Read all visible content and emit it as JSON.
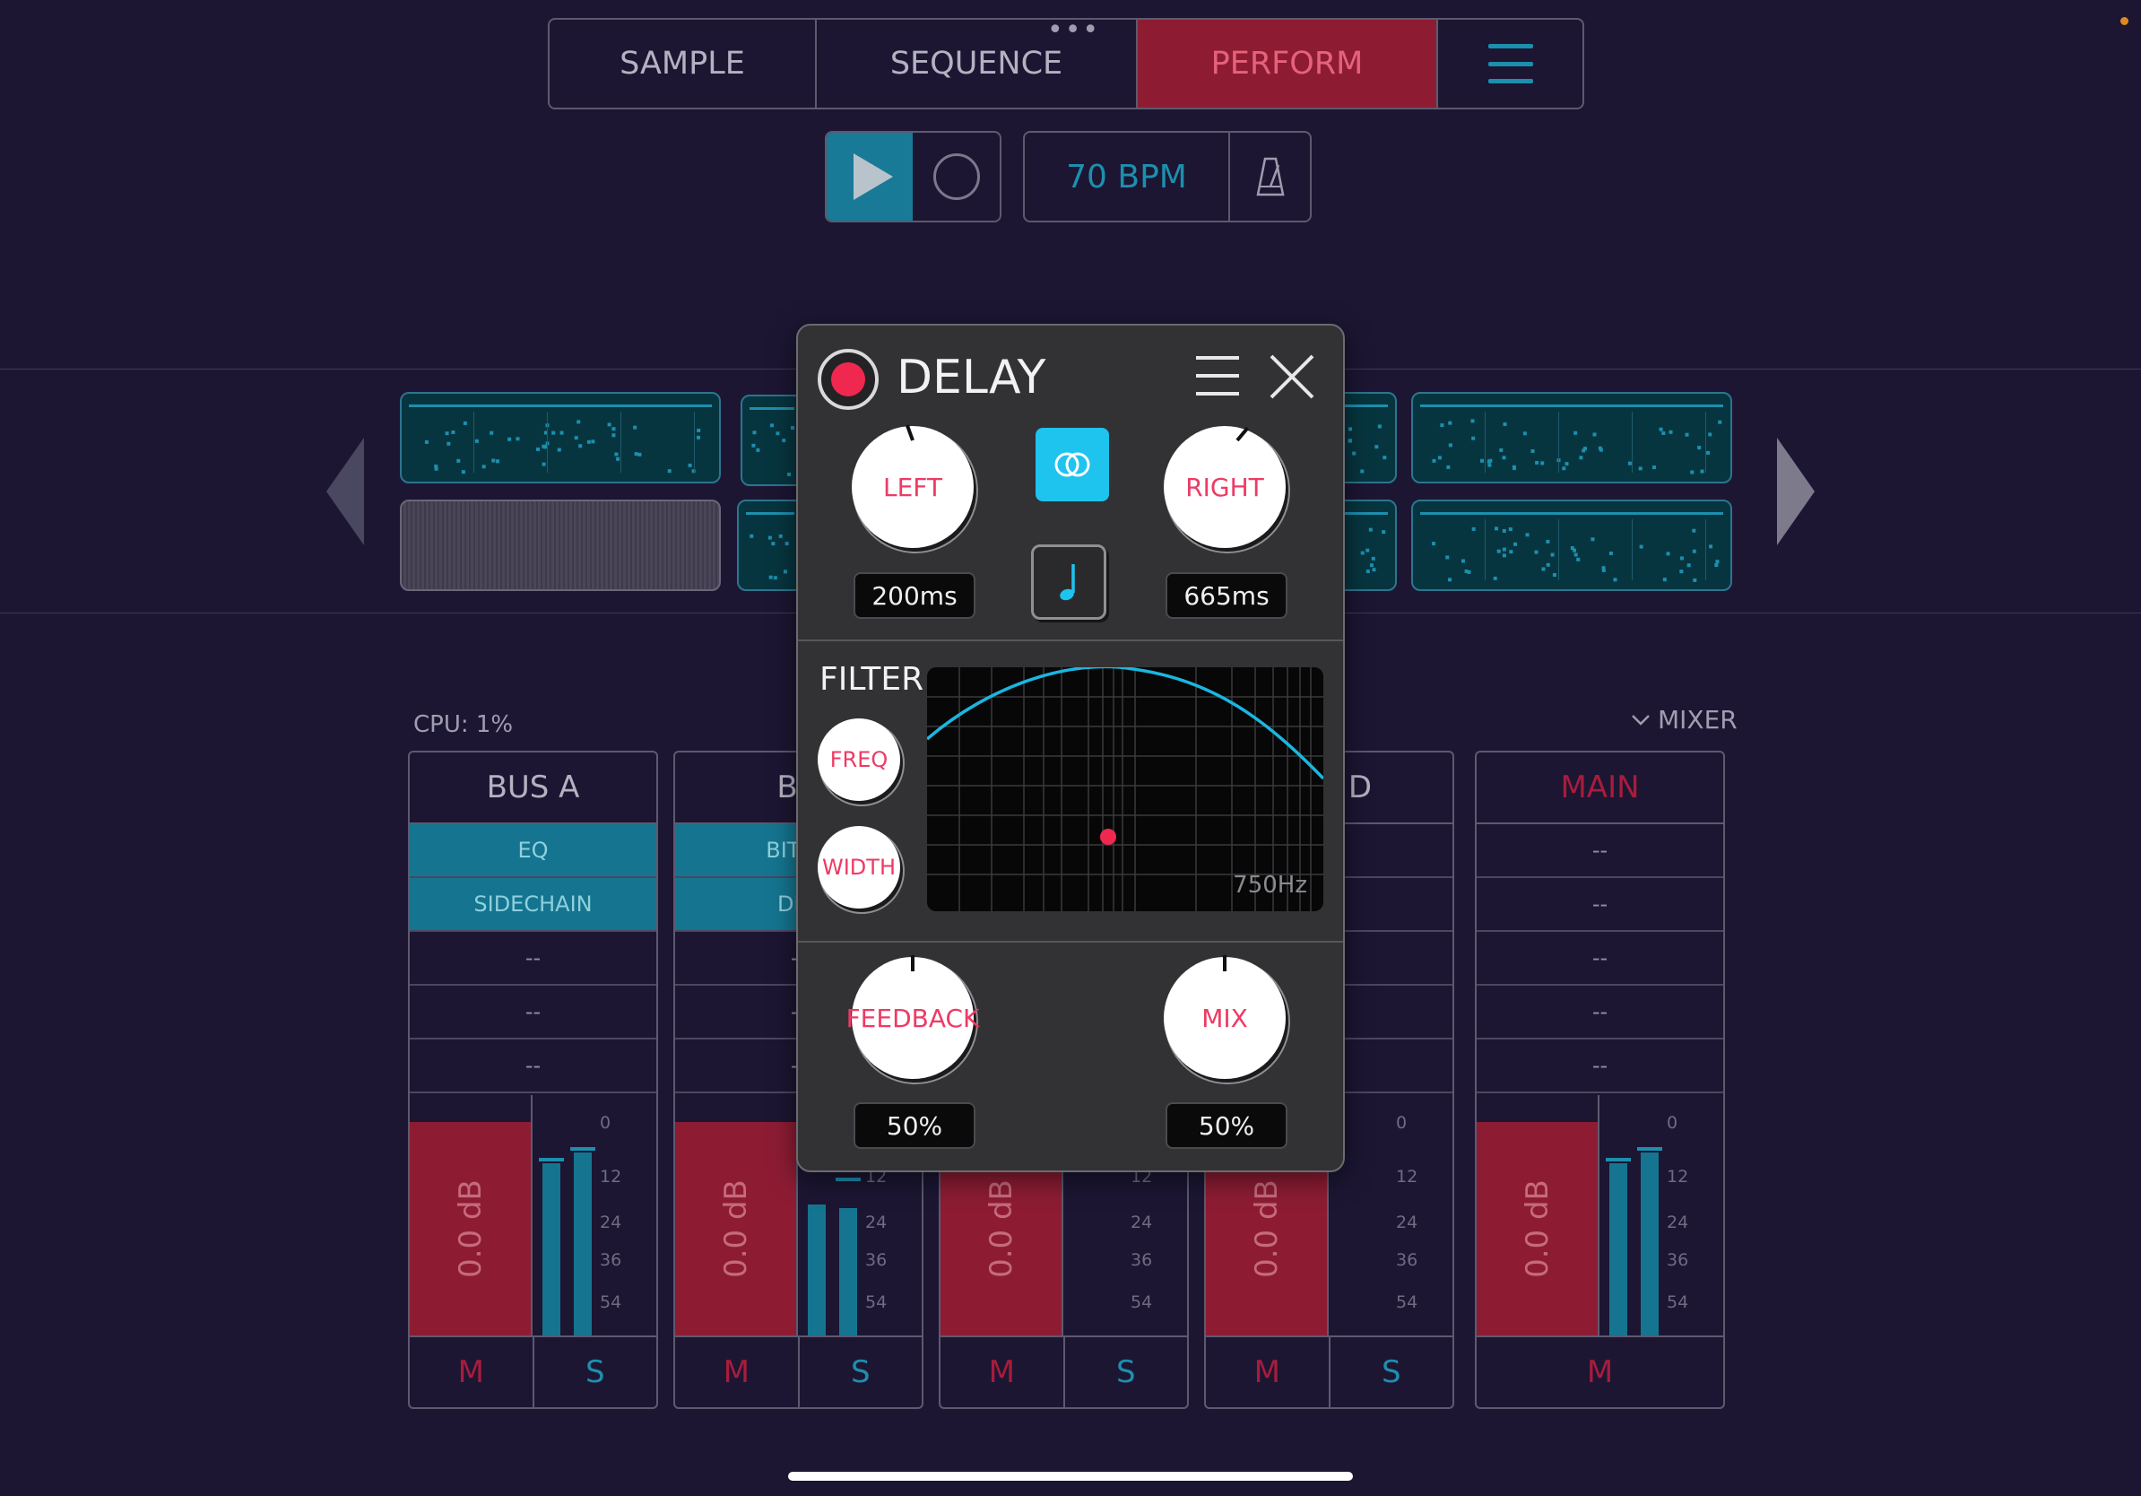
{
  "nav": {
    "tabs": [
      "SAMPLE",
      "SEQUENCE",
      "PERFORM"
    ],
    "active_tab": "PERFORM",
    "menu_icon": "hamburger-icon"
  },
  "transport": {
    "play_icon": "play-icon",
    "record_icon": "record-icon",
    "bpm": "70 BPM",
    "metronome_icon": "metronome-icon"
  },
  "mixer": {
    "cpu": "CPU: 1%",
    "toggle_label": "MIXER",
    "channels": [
      {
        "name": "BUS A",
        "slots": [
          "EQ",
          "SIDECHAIN",
          "--",
          "--",
          "--"
        ],
        "fader": "0.0 dB",
        "mute": "M",
        "solo": "S"
      },
      {
        "name": "BU",
        "slots": [
          "BITCO",
          "DEL",
          "--",
          "--",
          "--"
        ],
        "fader": "0.0 dB",
        "mute": "M",
        "solo": "S"
      },
      {
        "name": "",
        "slots": [
          "",
          "",
          "",
          "",
          ""
        ],
        "fader": "0.0 dB",
        "mute": "M",
        "solo": "S"
      },
      {
        "name": "D",
        "slots": [
          "",
          "",
          "",
          "",
          ""
        ],
        "fader": "0.0 dB",
        "mute": "M",
        "solo": "S"
      },
      {
        "name": "MAIN",
        "slots": [
          "--",
          "--",
          "--",
          "--",
          "--"
        ],
        "fader": "0.0 dB",
        "mute": "M"
      }
    ],
    "scale": [
      "0",
      "12",
      "24",
      "36",
      "54"
    ]
  },
  "delay": {
    "title": "DELAY",
    "left_label": "LEFT",
    "left_value": "200ms",
    "right_label": "RIGHT",
    "right_value": "665ms",
    "filter_label": "FILTER",
    "freq_label": "FREQ",
    "width_label": "WIDTH",
    "filter_freq": "750Hz",
    "feedback_label": "FEEDBACK",
    "feedback_value": "50%",
    "mix_label": "MIX",
    "mix_value": "50%"
  },
  "colors": {
    "background": "#1c1633",
    "accent_teal": "#1d8fae",
    "accent_red": "#8d1c33",
    "knob_text": "#ee3a64",
    "link_button": "#1ec3ee"
  }
}
